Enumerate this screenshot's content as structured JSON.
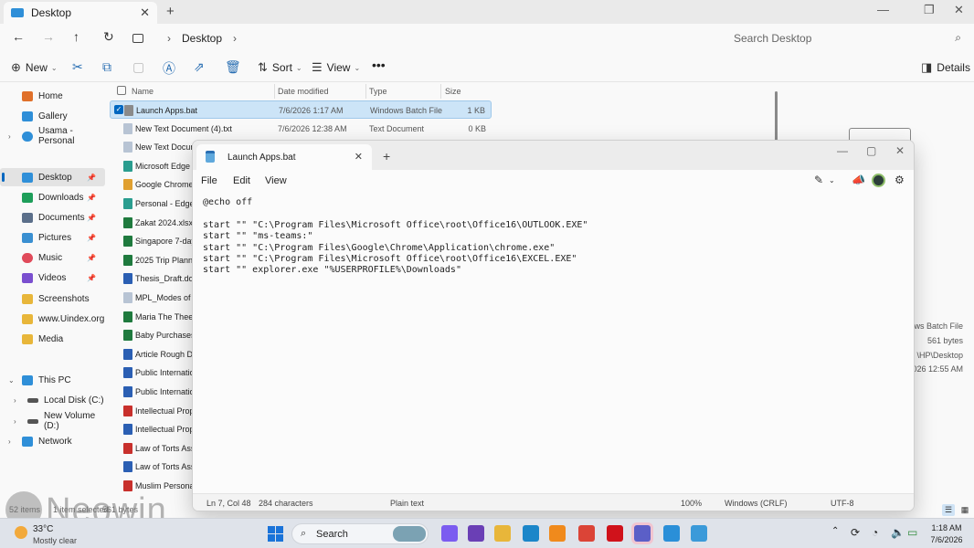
{
  "explorer": {
    "tab_title": "Desktop",
    "breadcrumb": "Desktop",
    "search_placeholder": "Search Desktop",
    "commands": {
      "new": "New",
      "sort": "Sort",
      "view": "View",
      "details": "Details"
    },
    "sidebar": [
      {
        "label": "Home",
        "color": "#e0702a"
      },
      {
        "label": "Gallery",
        "color": "#2f8fd8"
      },
      {
        "label": "Usama - Personal",
        "color": "#2f8fd8"
      },
      {
        "label": "Desktop",
        "color": "#2f8fd8"
      },
      {
        "label": "Downloads",
        "color": "#1e9e5a"
      },
      {
        "label": "Documents",
        "color": "#5b6f8a"
      },
      {
        "label": "Pictures",
        "color": "#3a8fd1"
      },
      {
        "label": "Music",
        "color": "#e04a5a"
      },
      {
        "label": "Videos",
        "color": "#7a4fcf"
      },
      {
        "label": "Screenshots",
        "color": "#e8b63a"
      },
      {
        "label": "www.Uindex.org",
        "color": "#e8b63a"
      },
      {
        "label": "Media",
        "color": "#e8b63a"
      },
      {
        "label": "This PC",
        "color": "#2f8fd8"
      },
      {
        "label": "Local Disk (C:)",
        "color": "#555555"
      },
      {
        "label": "New Volume (D:)",
        "color": "#555555"
      },
      {
        "label": "Network",
        "color": "#2f8fd8"
      }
    ],
    "columns": {
      "name": "Name",
      "date": "Date modified",
      "type": "Type",
      "size": "Size"
    },
    "files": [
      {
        "name": "Launch Apps.bat",
        "date": "7/6/2026 1:17 AM",
        "type": "Windows Batch File",
        "size": "1 KB",
        "icon_color": "#8a8a8a"
      },
      {
        "name": "New Text Document (4).txt",
        "date": "7/6/2026 12:38 AM",
        "type": "Text Document",
        "size": "0 KB",
        "icon_color": "#b8c4d4"
      },
      {
        "name": "New Text Docum",
        "date": "",
        "type": "",
        "size": "",
        "icon_color": "#b8c4d4"
      },
      {
        "name": "Microsoft Edge C",
        "date": "",
        "type": "",
        "size": "",
        "icon_color": "#2a9d8f"
      },
      {
        "name": "Google Chrome (",
        "date": "",
        "type": "",
        "size": "",
        "icon_color": "#e0a030"
      },
      {
        "name": "Personal - Edge",
        "date": "",
        "type": "",
        "size": "",
        "icon_color": "#2a9d8f"
      },
      {
        "name": "Zakat 2024.xlsx",
        "date": "",
        "type": "",
        "size": "",
        "icon_color": "#1f7a3e"
      },
      {
        "name": "Singapore 7-day",
        "date": "",
        "type": "",
        "size": "",
        "icon_color": "#1f7a3e"
      },
      {
        "name": "2025 Trip Plannin",
        "date": "",
        "type": "",
        "size": "",
        "icon_color": "#1f7a3e"
      },
      {
        "name": "Thesis_Draft.doc",
        "date": "",
        "type": "",
        "size": "",
        "icon_color": "#2b5fb3"
      },
      {
        "name": "MPL_Modes of D",
        "date": "",
        "type": "",
        "size": "",
        "icon_color": "#b8c4d4"
      },
      {
        "name": "Maria The Theeti",
        "date": "",
        "type": "",
        "size": "",
        "icon_color": "#1f7a3e"
      },
      {
        "name": "Baby Purchases.x",
        "date": "",
        "type": "",
        "size": "",
        "icon_color": "#1f7a3e"
      },
      {
        "name": "Article Rough Dr",
        "date": "",
        "type": "",
        "size": "",
        "icon_color": "#2b5fb3"
      },
      {
        "name": "Public Internation",
        "date": "",
        "type": "",
        "size": "",
        "icon_color": "#2b5fb3"
      },
      {
        "name": "Public Internation",
        "date": "",
        "type": "",
        "size": "",
        "icon_color": "#2b5fb3"
      },
      {
        "name": "Intellectual Prope",
        "date": "",
        "type": "",
        "size": "",
        "icon_color": "#c8302c"
      },
      {
        "name": "Intellectual Prope",
        "date": "",
        "type": "",
        "size": "",
        "icon_color": "#2b5fb3"
      },
      {
        "name": "Law of Torts Assi",
        "date": "",
        "type": "",
        "size": "",
        "icon_color": "#c8302c"
      },
      {
        "name": "Law of Torts Assi",
        "date": "",
        "type": "",
        "size": "",
        "icon_color": "#2b5fb3"
      },
      {
        "name": "Muslim Personal",
        "date": "",
        "type": "",
        "size": "",
        "icon_color": "#c8302c"
      }
    ],
    "details_pane": {
      "type_fragment": "ows Batch File",
      "size": "561 bytes",
      "path_fragment": "\\HP\\Desktop",
      "date_fragment": "026 12:55 AM"
    },
    "status": {
      "item_count": "52 items",
      "selected": "1 item selected",
      "size_fragment": "561 bytes"
    }
  },
  "notepad": {
    "tab_title": "Launch Apps.bat",
    "menu": {
      "file": "File",
      "edit": "Edit",
      "view": "View"
    },
    "lines": [
      "@echo off",
      "",
      "start \"\" \"C:\\Program Files\\Microsoft Office\\root\\Office16\\OUTLOOK.EXE\"",
      "start \"\" \"ms-teams:\"",
      "start \"\" \"C:\\Program Files\\Google\\Chrome\\Application\\chrome.exe\"",
      "start \"\" \"C:\\Program Files\\Microsoft Office\\root\\Office16\\EXCEL.EXE\"",
      "start \"\" explorer.exe \"%USERPROFILE%\\Downloads\""
    ],
    "status": {
      "position": "Ln 7, Col 48",
      "characters": "284 characters",
      "format": "Plain text",
      "zoom": "100%",
      "line_ending": "Windows (CRLF)",
      "encoding": "UTF-8"
    }
  },
  "taskbar": {
    "weather_temp": "33°C",
    "weather_condition": "Mostly clear",
    "search_label": "Search",
    "time": "1:18 AM",
    "date": "7/6/2026",
    "apps": [
      {
        "name": "copilot-icon",
        "color": "#7b5cf0"
      },
      {
        "name": "browser-icon",
        "color": "#6a3fb5"
      },
      {
        "name": "file-explorer-icon",
        "color": "#e8b63a"
      },
      {
        "name": "photos-icon",
        "color": "#1b86c9"
      },
      {
        "name": "vlc-icon",
        "color": "#f08a1c"
      },
      {
        "name": "chrome-icon",
        "color": "#db4437"
      },
      {
        "name": "netflix-icon",
        "color": "#d0121b"
      },
      {
        "name": "teams-icon",
        "color": "#5b5fc7"
      },
      {
        "name": "snipping-tool-icon",
        "color": "#2a8fd8"
      },
      {
        "name": "notepad-icon",
        "color": "#3b9ad9"
      }
    ]
  },
  "watermark": "Neowin"
}
